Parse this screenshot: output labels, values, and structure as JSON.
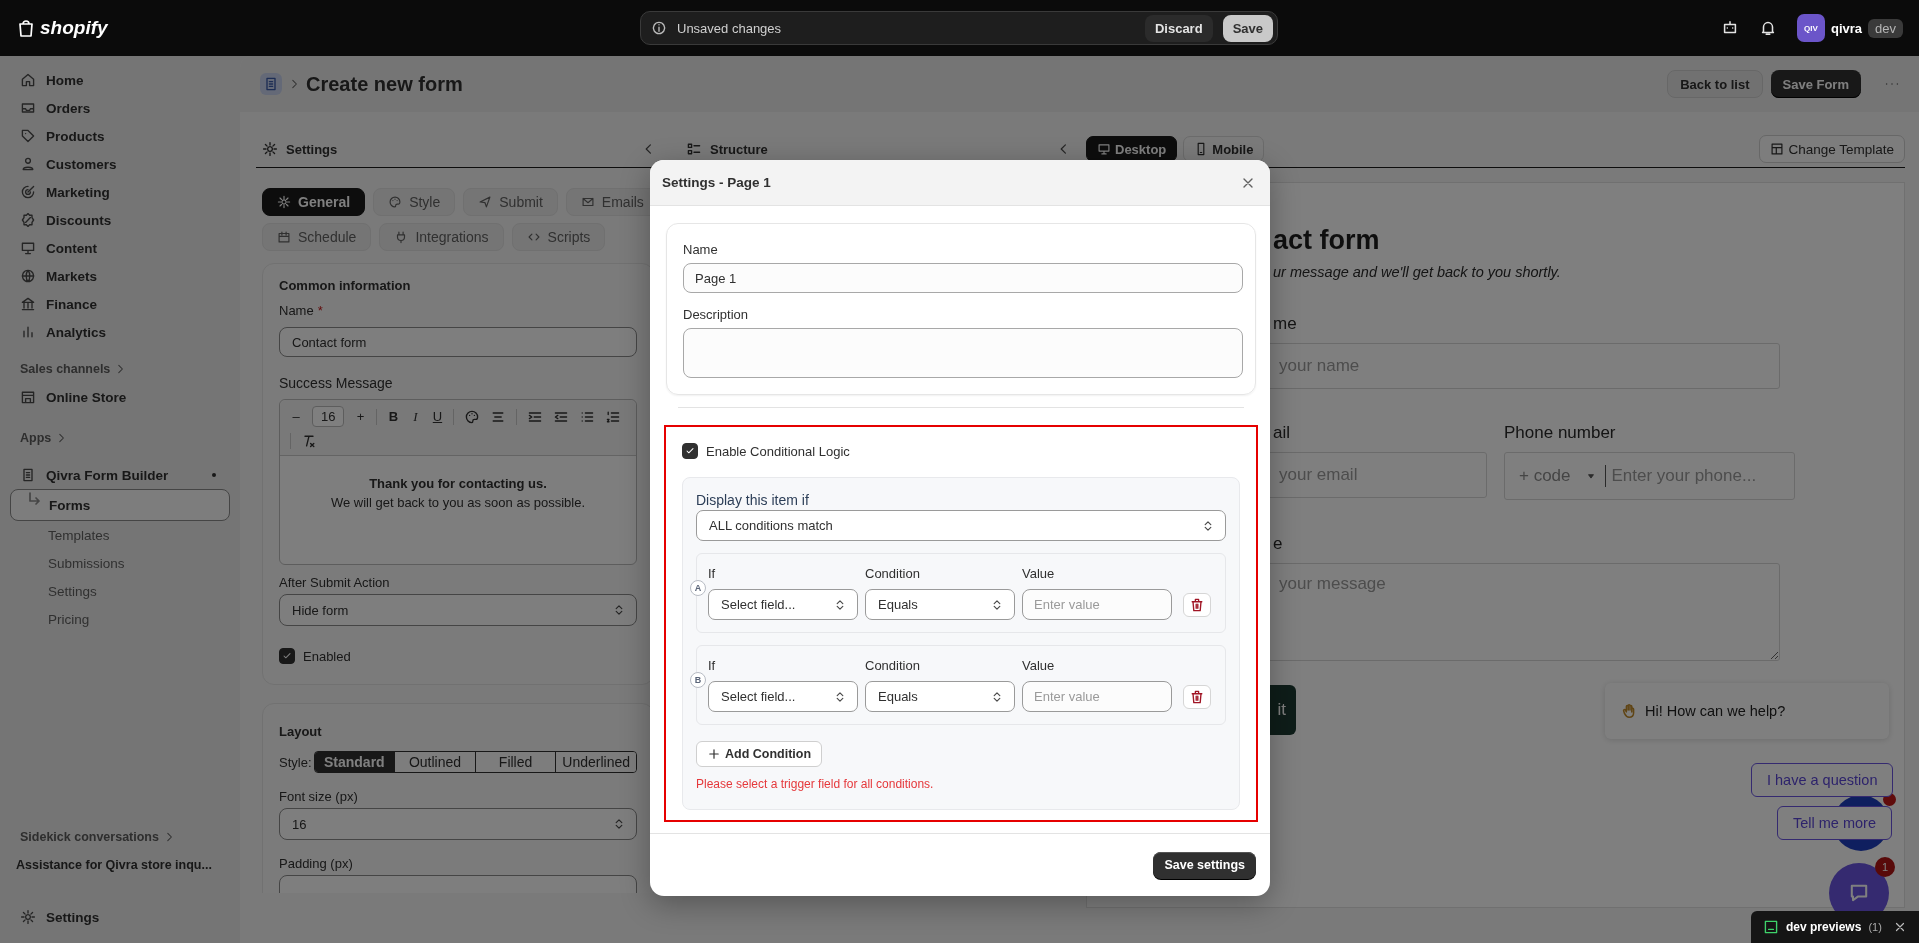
{
  "top_bar": {
    "logo": "shopify",
    "unsaved": {
      "message": "Unsaved changes",
      "discard": "Discard",
      "save": "Save"
    },
    "store": {
      "initials": "QIV",
      "name": "qivra",
      "badge": "dev"
    }
  },
  "sidebar": {
    "main_nav": [
      {
        "label": "Home",
        "selected": false
      },
      {
        "label": "Orders",
        "selected": false
      },
      {
        "label": "Products",
        "selected": false
      },
      {
        "label": "Customers",
        "selected": false
      },
      {
        "label": "Marketing",
        "selected": false
      },
      {
        "label": "Discounts",
        "selected": false
      },
      {
        "label": "Content",
        "selected": false
      },
      {
        "label": "Markets",
        "selected": false
      },
      {
        "label": "Finance",
        "selected": false
      },
      {
        "label": "Analytics",
        "selected": false
      }
    ],
    "sales_channels": {
      "label": "Sales channels",
      "items": [
        {
          "label": "Online Store",
          "selected": false
        }
      ]
    },
    "apps": {
      "label": "Apps",
      "app": {
        "label": "Qivra Form Builder",
        "pinned": true,
        "items": [
          {
            "label": "Forms",
            "selected": true
          },
          {
            "label": "Templates",
            "selected": false
          },
          {
            "label": "Submissions",
            "selected": false
          },
          {
            "label": "Settings",
            "selected": false
          },
          {
            "label": "Pricing",
            "selected": false
          }
        ]
      }
    },
    "sidekick": {
      "label": "Sidekick conversations",
      "items": [
        "Assistance for Qivra store inqu..."
      ]
    },
    "settings": {
      "label": "Settings",
      "selected": false
    }
  },
  "page_header": {
    "title": "Create new form",
    "actions": [
      {
        "label": "Back to list",
        "kind": "secondary"
      },
      {
        "label": "Save Form",
        "kind": "primary"
      }
    ]
  },
  "settings_panel": {
    "title": "Settings",
    "tabs": [
      {
        "label": "General",
        "selected": true
      },
      {
        "label": "Style",
        "selected": false
      },
      {
        "label": "Submit",
        "selected": false
      },
      {
        "label": "Emails",
        "selected": false
      },
      {
        "label": "Schedule",
        "selected": false
      },
      {
        "label": "Integrations",
        "selected": false
      },
      {
        "label": "Scripts",
        "selected": false
      }
    ],
    "common": {
      "title": "Common information",
      "name_label": "Name",
      "required_mark": "*",
      "name_value": "Contact form",
      "success_label": "Success Message",
      "toolbar": {
        "decrease": "–",
        "size": "16",
        "increase": "+",
        "marks": [
          "B",
          "I",
          "U"
        ]
      },
      "message": {
        "heading": "Thank you for contacting us.",
        "body": "We will get back to you as soon as possible."
      },
      "after_label": "After Submit Action",
      "after_value": "Hide form",
      "enabled": {
        "label": "Enabled",
        "checked": true
      }
    },
    "layout": {
      "title": "Layout",
      "style_label": "Style:",
      "styles": [
        {
          "label": "Standard",
          "selected": true
        },
        {
          "label": "Outlined",
          "selected": false
        },
        {
          "label": "Filled",
          "selected": false
        },
        {
          "label": "Underlined",
          "selected": false
        }
      ],
      "font_size_label": "Font size (px)",
      "font_size_value": "16",
      "padding_label": "Padding (px)"
    }
  },
  "structure_panel": {
    "title": "Structure"
  },
  "preview": {
    "devices": [
      {
        "label": "Desktop",
        "selected": true
      },
      {
        "label": "Mobile",
        "selected": false
      }
    ],
    "change_template": "Change Template",
    "form": {
      "title": "act form",
      "subtitle": "ur message and we'll get back to you shortly.",
      "name_label": "me",
      "name_placeholder": "your name",
      "email_label": "ail",
      "email_placeholder": "your email",
      "phone_label": "Phone number",
      "phone_code": "+ code",
      "phone_placeholder": "Enter your phone...",
      "message_label": "e",
      "message_placeholder": "your message",
      "submit": "it"
    },
    "chat": {
      "greeting": "Hi! How can we help?",
      "replies": [
        "I have a question",
        "Tell me more"
      ],
      "badge": "1"
    }
  },
  "modal": {
    "title": "Settings - Page 1",
    "name_label": "Name",
    "name_value": "Page 1",
    "description_label": "Description",
    "conditional": {
      "highlighted": true,
      "enable": {
        "label": "Enable Conditional Logic",
        "checked": true
      },
      "display_label": "Display this item if",
      "match": "ALL conditions match",
      "conditions": [
        {
          "letter": "A",
          "if_label": "If",
          "field": "Select field...",
          "condition_label": "Condition",
          "operator": "Equals",
          "value_label": "Value",
          "value_placeholder": "Enter value"
        },
        {
          "letter": "B",
          "if_label": "If",
          "field": "Select field...",
          "condition_label": "Condition",
          "operator": "Equals",
          "value_label": "Value",
          "value_placeholder": "Enter value"
        }
      ],
      "add": "Add Condition",
      "error": "Please select a trigger field for all conditions."
    },
    "save": "Save settings"
  },
  "dev_bar": {
    "label": "dev previews",
    "count": "(1)"
  }
}
